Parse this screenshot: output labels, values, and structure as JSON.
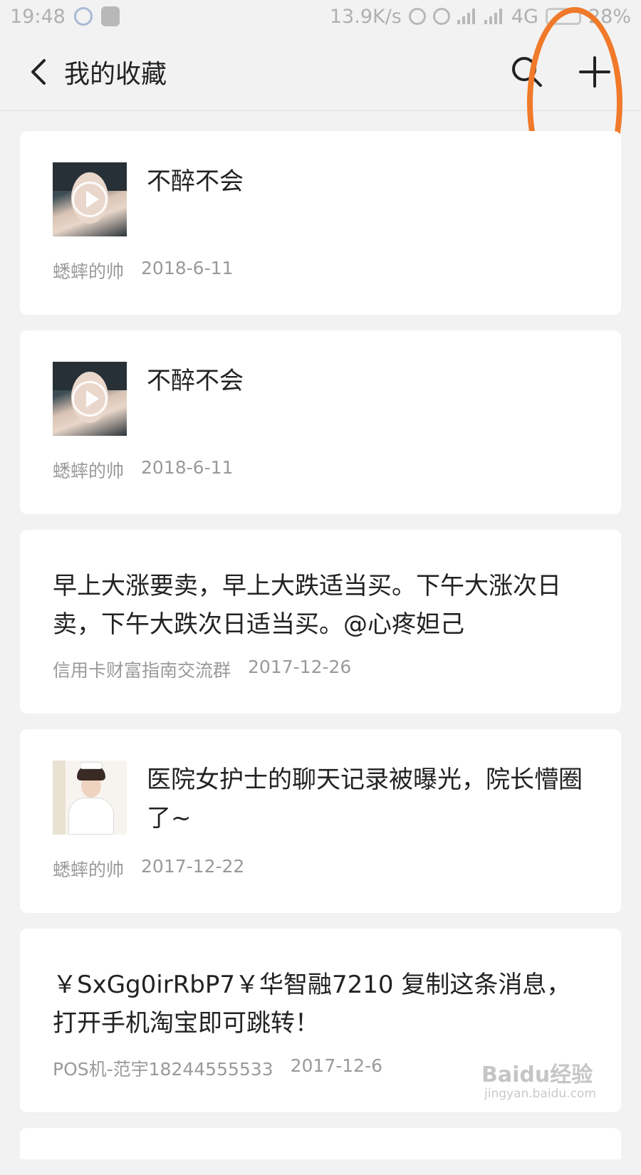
{
  "status_bar": {
    "time": "19:48",
    "network_speed": "13.9K/s",
    "network_type": "4G",
    "battery": "28%"
  },
  "header": {
    "title": "我的收藏",
    "back_icon": "chevron-left-icon",
    "search_icon": "search-icon",
    "add_icon": "plus-icon"
  },
  "favorites": [
    {
      "type": "video",
      "title": "不醉不会",
      "source": "蟋蟀的帅",
      "date": "2018-6-11"
    },
    {
      "type": "video",
      "title": "不醉不会",
      "source": "蟋蟀的帅",
      "date": "2018-6-11"
    },
    {
      "type": "text",
      "title": "早上大涨要卖，早上大跌适当买。下午大涨次日卖，下午大跌次日适当买。@心疼妲己",
      "source": "信用卡财富指南交流群",
      "date": "2017-12-26"
    },
    {
      "type": "article",
      "title": "医院女护士的聊天记录被曝光，院长懵圈了~",
      "source": "蟋蟀的帅",
      "date": "2017-12-22"
    },
    {
      "type": "text",
      "title": "￥SxGg0irRbP7￥华智融7210 复制这条消息，打开手机淘宝即可跳转！",
      "source": "POS机-范宇18244555533",
      "date": "2017-12-6"
    }
  ],
  "annotation": {
    "color": "#f07a2a"
  },
  "watermark": {
    "text": "Baidu经验",
    "url": "jingyan.baidu.com"
  }
}
